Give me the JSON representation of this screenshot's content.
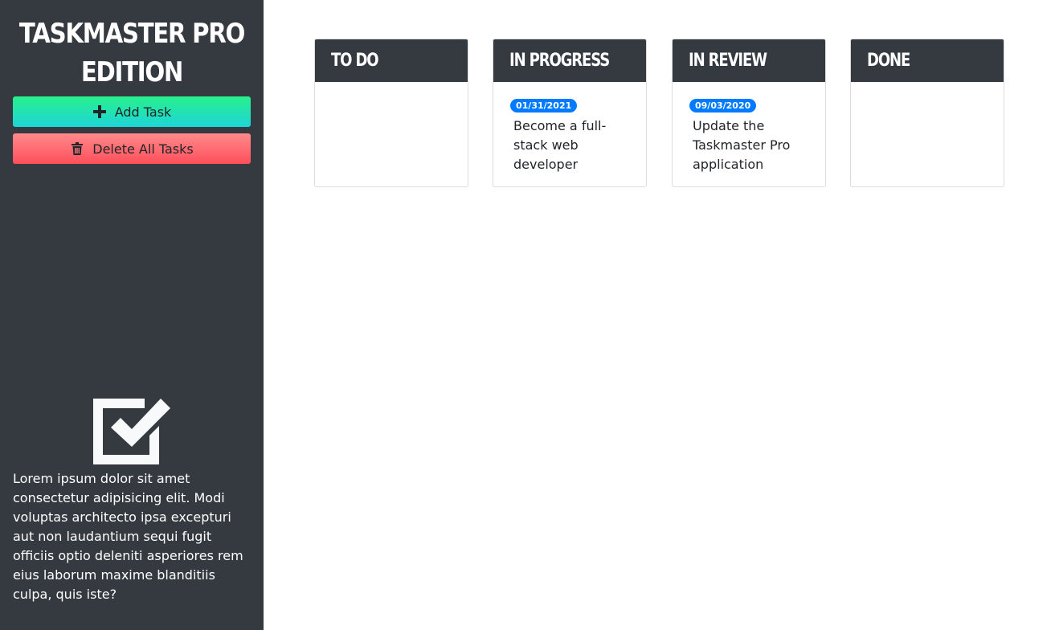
{
  "sidebar": {
    "title": "Taskmaster Pro Edition",
    "add_button": {
      "label": "Add Task",
      "icon": "plus-icon"
    },
    "delete_button": {
      "label": "Delete All Tasks",
      "icon": "trash-icon"
    },
    "logo_icon": "checkbox-check-icon",
    "description": "Lorem ipsum dolor sit amet consectetur adipisicing elit. Modi voluptas architecto ipsa excepturi aut non laudantium sequi fugit officiis optio deleniti asperiores rem eius laborum maxime blanditiis culpa, quis iste?"
  },
  "board": {
    "columns": [
      {
        "title": "To Do",
        "tasks": []
      },
      {
        "title": "In Progress",
        "tasks": [
          {
            "date": "01/31/2021",
            "text": "Become a full-stack web developer"
          }
        ]
      },
      {
        "title": "In Review",
        "tasks": [
          {
            "date": "09/03/2020",
            "text": "Update the Taskmaster Pro application"
          }
        ]
      },
      {
        "title": "Done",
        "tasks": []
      }
    ]
  },
  "colors": {
    "sidebar_bg": "#343a40",
    "badge_blue": "#007bff",
    "add_gradient": [
      "#28f08c",
      "#1ed5d8"
    ],
    "delete_gradient": [
      "#ff8a8a",
      "#fd4f5b"
    ]
  }
}
